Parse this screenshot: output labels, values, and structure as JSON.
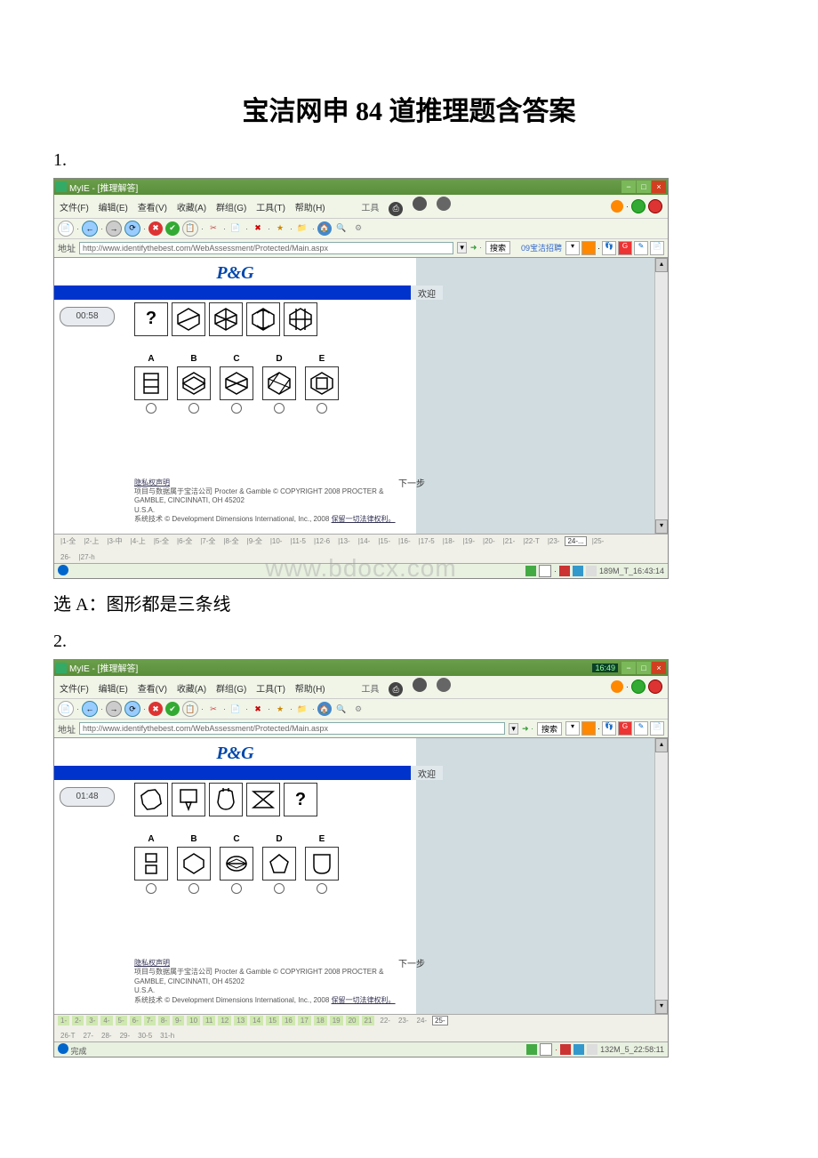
{
  "title": "宝洁网申 84 道推理题含答案",
  "q1": {
    "num": "1.",
    "titlebar": "MyIE - [推理解答]",
    "menu": [
      "文件(F)",
      "编辑(E)",
      "查看(V)",
      "收藏(A)",
      "群组(G)",
      "工具(T)",
      "帮助(H)"
    ],
    "menu_right_label": "工具",
    "addr_label": "地址",
    "url": "http://www.identifythebest.com/WebAssessment/Protected/Main.aspx",
    "search_btn": "搜索",
    "search_link": "09宝洁招聘",
    "logo": "P&G",
    "welcome": "欢迎",
    "timer": "00:58",
    "question_mark": "?",
    "answer_labels": [
      "A",
      "B",
      "C",
      "D",
      "E"
    ],
    "next": "下一步",
    "footer_l1": "隐私权声明",
    "footer_l2": "项目与数据属于宝洁公司  Procter & Gamble © COPYRIGHT 2008 PROCTER & GAMBLE, CINCINNATI, OH 45202",
    "footer_l3": "U.S.A.",
    "footer_l4_a": "系统技术 © Development Dimensions International, Inc., 2008 ",
    "footer_l4_b": "保留一切法律权利。",
    "tabs": [
      "|1-全",
      "|2-上",
      "|3-中",
      "|4-上",
      "|5-全",
      "|6-全",
      "|7-全",
      "|8-全",
      "|9-全",
      "|10-",
      "|11-5",
      "|12-6",
      "|13-",
      "|14-",
      "|15-",
      "|16-",
      "|17-5",
      "|18-",
      "|19-",
      "|20-",
      "|21-",
      "|22-T",
      "|23-",
      "24-...",
      "|25-"
    ],
    "tabs2": [
      "26-",
      "|27-h",
      "|"
    ],
    "status_left": "",
    "status_right": "189M_T_16:43:14",
    "answer": "选 A：图形都是三条线"
  },
  "q2": {
    "num": "2.",
    "titlebar": "MyIE - [推理解答]",
    "titlebar_time": "16:49",
    "menu": [
      "文件(F)",
      "编辑(E)",
      "查看(V)",
      "收藏(A)",
      "群组(G)",
      "工具(T)",
      "帮助(H)"
    ],
    "menu_right_label": "工具",
    "addr_label": "地址",
    "url": "http://www.identifythebest.com/WebAssessment/Protected/Main.aspx",
    "search_btn": "搜索",
    "logo": "P&G",
    "welcome": "欢迎",
    "timer": "01:48",
    "question_mark": "?",
    "answer_labels": [
      "A",
      "B",
      "C",
      "D",
      "E"
    ],
    "next": "下一步",
    "footer_l1": "隐私权声明",
    "footer_l2": "项目与数据属于宝洁公司  Procter & Gamble © COPYRIGHT 2008 PROCTER & GAMBLE, CINCINNATI, OH 45202",
    "footer_l3": "U.S.A.",
    "footer_l4_a": "系统技术 © Development Dimensions International, Inc., 2008 ",
    "footer_l4_b": "保留一切法律权利。",
    "tabs": [
      "1-",
      "2-",
      "3-",
      "4-",
      "5-",
      "6-",
      "7-",
      "8-",
      "9-",
      "10",
      "11",
      "12",
      "13",
      "14",
      "15",
      "16",
      "17",
      "18",
      "19",
      "20",
      "21",
      "22-",
      "23-",
      "24-",
      "25-"
    ],
    "tabs2": [
      "26-T",
      "27-",
      "28-",
      "29-",
      "30-5",
      "31-h",
      "|"
    ],
    "status_left": "完成",
    "status_right": "132M_5_22:58:11"
  },
  "watermark": "www.bdocx.com"
}
